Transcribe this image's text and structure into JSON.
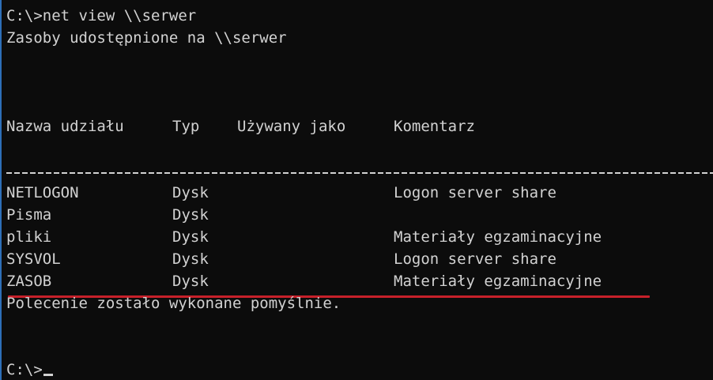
{
  "console": {
    "command_line": "C:\\>net view \\\\serwer",
    "subtitle": "Zasoby udostępnione na \\\\serwer",
    "columns": {
      "name": "Nazwa udziału",
      "type": "Typ",
      "used_as": "Używany jako",
      "comment": "Komentarz"
    },
    "shares": [
      {
        "name": "NETLOGON",
        "type": "Dysk",
        "comment": "Logon server share"
      },
      {
        "name": "Pisma",
        "type": "Dysk",
        "comment": ""
      },
      {
        "name": "pliki",
        "type": "Dysk",
        "comment": "Materiały egzaminacyjne"
      },
      {
        "name": "SYSVOL",
        "type": "Dysk",
        "comment": "Logon server share"
      },
      {
        "name": "ZASOB",
        "type": "Dysk",
        "comment": "Materiały egzaminacyjne"
      }
    ],
    "status": "Polecenie zostało wykonane pomyślnie.",
    "prompt": "C:\\>"
  },
  "colors": {
    "background": "#0c0c0c",
    "text": "#d2d2d2",
    "annotation_underline": "#c7202a"
  }
}
